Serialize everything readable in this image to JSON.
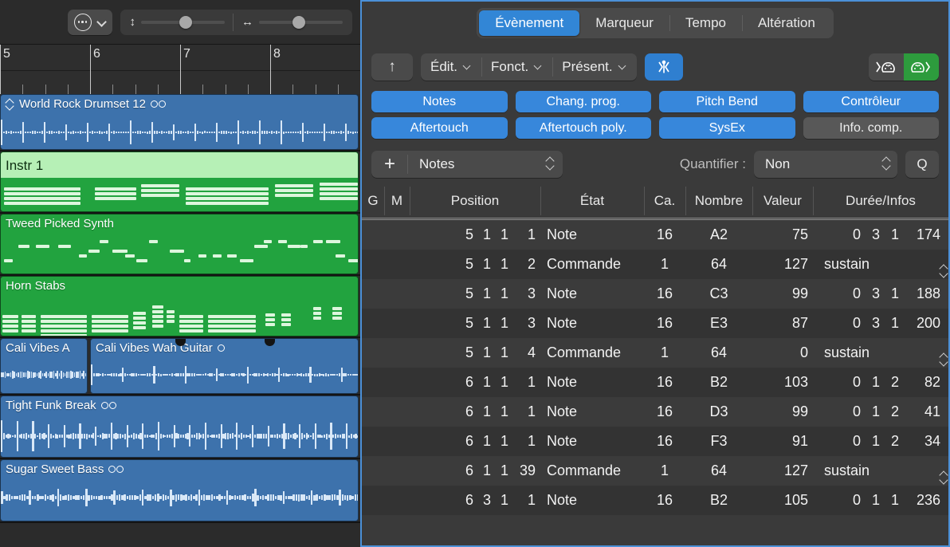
{
  "arrange": {
    "toolbar": {
      "mode_icon": "circle-ellipsis-icon",
      "chevron_icon": "chevron-down-icon",
      "vzoom_icon": "vertical-resize-icon",
      "hzoom_icon": "horizontal-resize-icon"
    },
    "ruler": {
      "bars": [
        "5",
        "6",
        "7",
        "8"
      ]
    },
    "regions": [
      {
        "name": "World Rock Drumset 12",
        "type": "audio",
        "loop": true,
        "chevron": true,
        "icon": "loop-icon"
      },
      {
        "name": "Instr 1",
        "type": "midi-selected",
        "loop": false,
        "chevron": false
      },
      {
        "name": "Tweed Picked Synth",
        "type": "midi",
        "loop": false,
        "chevron": false
      },
      {
        "name": "Horn Stabs",
        "type": "midi",
        "loop": false,
        "chevron": false
      },
      {
        "name": "Cali Vibes A",
        "type": "audio",
        "loop": false,
        "chevron": false
      },
      {
        "name": "Cali Vibes Wah Guitar",
        "type": "audio",
        "loop": true,
        "single_loop": true,
        "icon": "loop-icon"
      },
      {
        "name": "Tight Funk Break",
        "type": "audio",
        "loop": true,
        "icon": "loop-icon"
      },
      {
        "name": "Sugar Sweet Bass",
        "type": "audio",
        "loop": true,
        "icon": "loop-icon"
      }
    ]
  },
  "eventlist": {
    "tabs": [
      {
        "label": "Évènement",
        "active": true
      },
      {
        "label": "Marqueur",
        "active": false
      },
      {
        "label": "Tempo",
        "active": false
      },
      {
        "label": "Altération",
        "active": false
      }
    ],
    "toolbar": {
      "up_button_icon": "arrow-up-icon",
      "menus": [
        {
          "label": "Édit."
        },
        {
          "label": "Fonct."
        },
        {
          "label": "Présent."
        }
      ],
      "catch_icon": "catch-playhead-icon",
      "midi_in_icon": "midi-in-icon",
      "midi_out_icon": "midi-out-icon"
    },
    "filters": [
      {
        "label": "Notes",
        "on": true
      },
      {
        "label": "Chang. prog.",
        "on": true
      },
      {
        "label": "Pitch Bend",
        "on": true
      },
      {
        "label": "Contrôleur",
        "on": true
      },
      {
        "label": "Aftertouch",
        "on": true
      },
      {
        "label": "Aftertouch poly.",
        "on": true
      },
      {
        "label": "SysEx",
        "on": true
      },
      {
        "label": "Info. comp.",
        "on": false
      }
    ],
    "addrow": {
      "plus_label": "+",
      "create_value": "Notes",
      "quantize_label": "Quantifier :",
      "quantize_value": "Non",
      "q_button": "Q"
    },
    "columns": [
      "G",
      "M",
      "Position",
      "État",
      "Ca.",
      "Nombre",
      "Valeur",
      "Durée/Infos"
    ],
    "rows": [
      {
        "pos": [
          "5",
          "1",
          "1",
          "1"
        ],
        "status": "Note",
        "ca": "16",
        "nombre": "A2",
        "valeur": "75",
        "dur": [
          "0",
          "3",
          "1",
          "174"
        ],
        "info": ""
      },
      {
        "pos": [
          "5",
          "1",
          "1",
          "2"
        ],
        "status": "Commande",
        "ca": "1",
        "nombre": "64",
        "valeur": "127",
        "dur": null,
        "info": "sustain"
      },
      {
        "pos": [
          "5",
          "1",
          "1",
          "3"
        ],
        "status": "Note",
        "ca": "16",
        "nombre": "C3",
        "valeur": "99",
        "dur": [
          "0",
          "3",
          "1",
          "188"
        ],
        "info": ""
      },
      {
        "pos": [
          "5",
          "1",
          "1",
          "3"
        ],
        "status": "Note",
        "ca": "16",
        "nombre": "E3",
        "valeur": "87",
        "dur": [
          "0",
          "3",
          "1",
          "200"
        ],
        "info": ""
      },
      {
        "pos": [
          "5",
          "1",
          "1",
          "4"
        ],
        "status": "Commande",
        "ca": "1",
        "nombre": "64",
        "valeur": "0",
        "dur": null,
        "info": "sustain"
      },
      {
        "pos": [
          "6",
          "1",
          "1",
          "1"
        ],
        "status": "Note",
        "ca": "16",
        "nombre": "B2",
        "valeur": "103",
        "dur": [
          "0",
          "1",
          "2",
          "82"
        ],
        "info": ""
      },
      {
        "pos": [
          "6",
          "1",
          "1",
          "1"
        ],
        "status": "Note",
        "ca": "16",
        "nombre": "D3",
        "valeur": "99",
        "dur": [
          "0",
          "1",
          "2",
          "41"
        ],
        "info": ""
      },
      {
        "pos": [
          "6",
          "1",
          "1",
          "1"
        ],
        "status": "Note",
        "ca": "16",
        "nombre": "F3",
        "valeur": "91",
        "dur": [
          "0",
          "1",
          "2",
          "34"
        ],
        "info": ""
      },
      {
        "pos": [
          "6",
          "1",
          "1",
          "39"
        ],
        "status": "Commande",
        "ca": "1",
        "nombre": "64",
        "valeur": "127",
        "dur": null,
        "info": "sustain"
      },
      {
        "pos": [
          "6",
          "3",
          "1",
          "1"
        ],
        "status": "Note",
        "ca": "16",
        "nombre": "B2",
        "valeur": "105",
        "dur": [
          "0",
          "1",
          "1",
          "236"
        ],
        "info": ""
      }
    ]
  },
  "colors": {
    "accent_blue": "#3286d6",
    "filter_blue": "#3787db",
    "midi_green": "#2d9b3d",
    "region_audio": "#3d72ac",
    "region_midi": "#22a33f",
    "focus_border": "#4b90d8"
  }
}
